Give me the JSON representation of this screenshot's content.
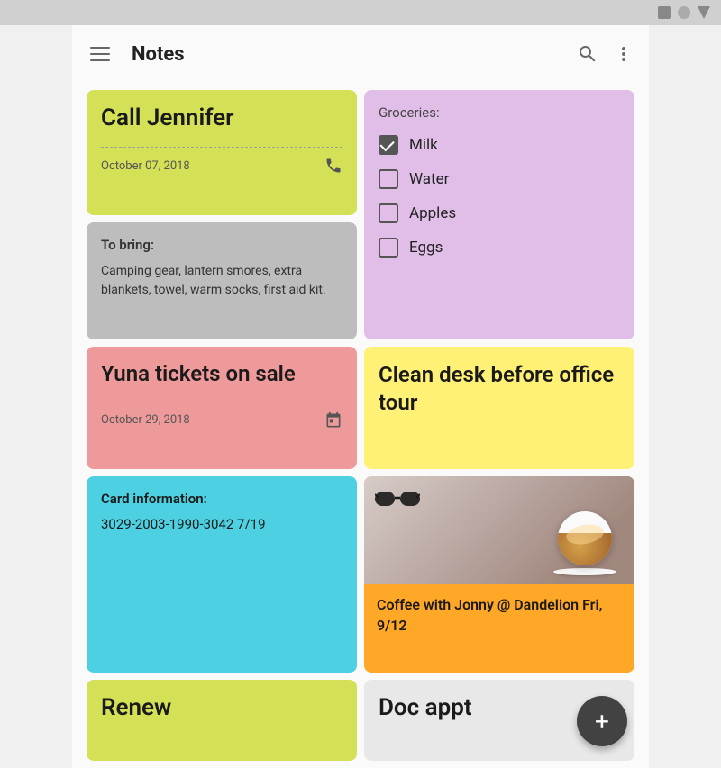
{
  "statusBar": {
    "icons": [
      "square",
      "circle",
      "triangle"
    ]
  },
  "toolbar": {
    "title": "Notes",
    "searchLabel": "search",
    "moreLabel": "more"
  },
  "notes": {
    "callJennifer": {
      "title": "Call Jennifer",
      "date": "October 07, 2018",
      "bg": "#d4e157"
    },
    "camping": {
      "label": "To bring:",
      "body": "Camping gear, lantern smores, extra blankets, towel, warm socks, first aid kit.",
      "bg": "#bdbdbd"
    },
    "groceries": {
      "label": "Groceries:",
      "items": [
        {
          "text": "Milk",
          "checked": true
        },
        {
          "text": "Water",
          "checked": false
        },
        {
          "text": "Apples",
          "checked": false
        },
        {
          "text": "Eggs",
          "checked": false
        }
      ],
      "bg": "#e1bee7"
    },
    "cleanDesk": {
      "title": "Clean desk before office tour",
      "bg": "#fff176"
    },
    "yunaTickets": {
      "title": "Yuna tickets on sale",
      "date": "October 29, 2018",
      "bg": "#ef9a9a"
    },
    "coffee": {
      "title": "Coffee with Jonny @ Dandelion Fri, 9/12",
      "bg": "#ffa726"
    },
    "cardInfo": {
      "label": "Card information:",
      "body": "3029-2003-1990-3042 7/19",
      "bg": "#4dd0e1"
    },
    "renew": {
      "title": "Renew",
      "bg": "#d4e157"
    },
    "docAppt": {
      "title": "Doc appt",
      "bg": "#e8e8e8"
    }
  },
  "fab": {
    "label": "+"
  }
}
